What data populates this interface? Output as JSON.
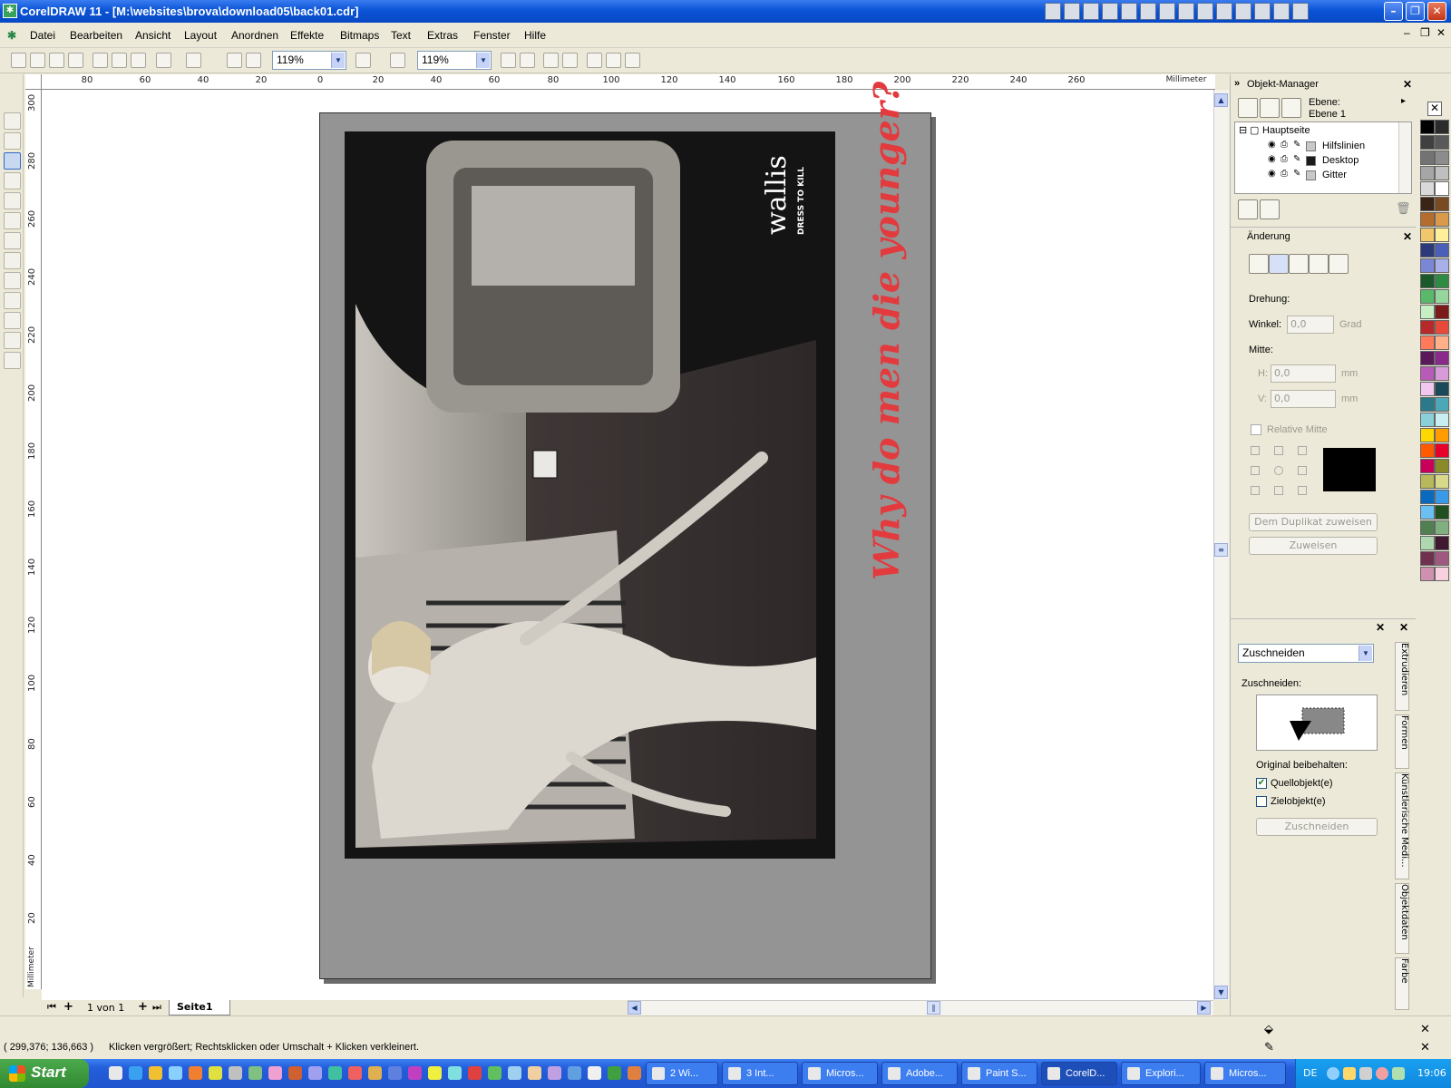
{
  "window": {
    "title": "CorelDRAW 11 - [M:\\websites\\brova\\download05\\back01.cdr]"
  },
  "menu": [
    "Datei",
    "Bearbeiten",
    "Ansicht",
    "Layout",
    "Anordnen",
    "Effekte",
    "Bitmaps",
    "Text",
    "Extras",
    "Fenster",
    "Hilfe"
  ],
  "toolbar": {
    "zoom1": "119%",
    "zoom2": "119%"
  },
  "rulers": {
    "unit": "Millimeter",
    "h_ticks": [
      "80",
      "60",
      "40",
      "20",
      "0",
      "20",
      "40",
      "60",
      "80",
      "100",
      "120",
      "140",
      "160",
      "180",
      "200",
      "220",
      "240",
      "260"
    ],
    "v_ticks": [
      "300",
      "280",
      "260",
      "240",
      "220",
      "200",
      "180",
      "160",
      "140",
      "120",
      "100",
      "80",
      "60",
      "40",
      "20"
    ]
  },
  "document": {
    "slogan": "Why do men die younger?",
    "logo_text": "wallis DRESS TO KILL"
  },
  "page_nav": {
    "counter": "1 von 1",
    "tab": "Seite1"
  },
  "object_manager": {
    "title": "Objekt-Manager",
    "layer_label": "Ebene:",
    "layer_value": "Ebene 1",
    "tree": {
      "root": "Hauptseite",
      "items": [
        {
          "name": "Hilfslinien",
          "color": "#c8c8c8"
        },
        {
          "name": "Desktop",
          "color": "#1a1a1a"
        },
        {
          "name": "Gitter",
          "color": "#c8c8c8"
        }
      ]
    }
  },
  "transform": {
    "title": "Änderung",
    "rotation_label": "Drehung:",
    "angle_label": "Winkel:",
    "angle_value": "0,0",
    "angle_unit": "Grad",
    "center_label": "Mitte:",
    "h_label": "H:",
    "h_value": "0,0",
    "h_unit": "mm",
    "v_label": "V:",
    "v_value": "0,0",
    "v_unit": "mm",
    "relative_center": "Relative Mitte",
    "apply_duplicate": "Dem Duplikat zuweisen",
    "apply": "Zuweisen"
  },
  "shaping": {
    "mode": "Zuschneiden",
    "mode_label": "Zuschneiden:",
    "keep_original": "Original beibehalten:",
    "source": "Quellobjekt(e)",
    "source_checked": true,
    "target": "Zielobjekt(e)",
    "target_checked": false,
    "button": "Zuschneiden"
  },
  "side_tabs": [
    "Extrudieren",
    "Formen",
    "Künstlerische Medi...",
    "Objektdaten",
    "Farbe"
  ],
  "palette": [
    "#000000",
    "#2b2b2b",
    "#404040",
    "#595959",
    "#737373",
    "#8c8c8c",
    "#a6a6a6",
    "#bfbfbf",
    "#d9d9d9",
    "#ffffff",
    "#3a2416",
    "#7a4a22",
    "#b46d2c",
    "#d99a4a",
    "#f2c66a",
    "#ffef9a",
    "#2a3a7a",
    "#4a5fb8",
    "#7a86d6",
    "#a8b0ea",
    "#1a5a2a",
    "#2f8a44",
    "#59b86a",
    "#95d69c",
    "#c8efc4",
    "#7a1a1a",
    "#b82a2a",
    "#e84a3a",
    "#ff7a5a",
    "#ffb08a",
    "#5a1a5a",
    "#8a2a8a",
    "#b85ab8",
    "#d89ad8",
    "#f0c8f0",
    "#1a4a5a",
    "#2a7a8a",
    "#4aa8b8",
    "#8ad0d8",
    "#c8eef2",
    "#ffd800",
    "#ff9c00",
    "#ff5a00",
    "#e8002a",
    "#c8005a",
    "#8a8a2a",
    "#b8b85a",
    "#d8d88a",
    "#0a6abf",
    "#3a9ae8",
    "#6ac0f2",
    "#205020",
    "#508050",
    "#80b080",
    "#b0d8b0",
    "#401830",
    "#703050",
    "#a05880",
    "#d090b0",
    "#f8d0e0"
  ],
  "status": {
    "coords": "( 299,376; 136,663 )",
    "hint": "Klicken vergrößert; Rechtsklicken oder Umschalt + Klicken verkleinert."
  },
  "taskbar": {
    "start": "Start",
    "tasks": [
      "2 Wi...",
      "3 Int...",
      "Micros...",
      "Adobe...",
      "Paint S...",
      "CorelD...",
      "Explori...",
      "Micros..."
    ],
    "lang": "DE",
    "clock": "19:06"
  }
}
